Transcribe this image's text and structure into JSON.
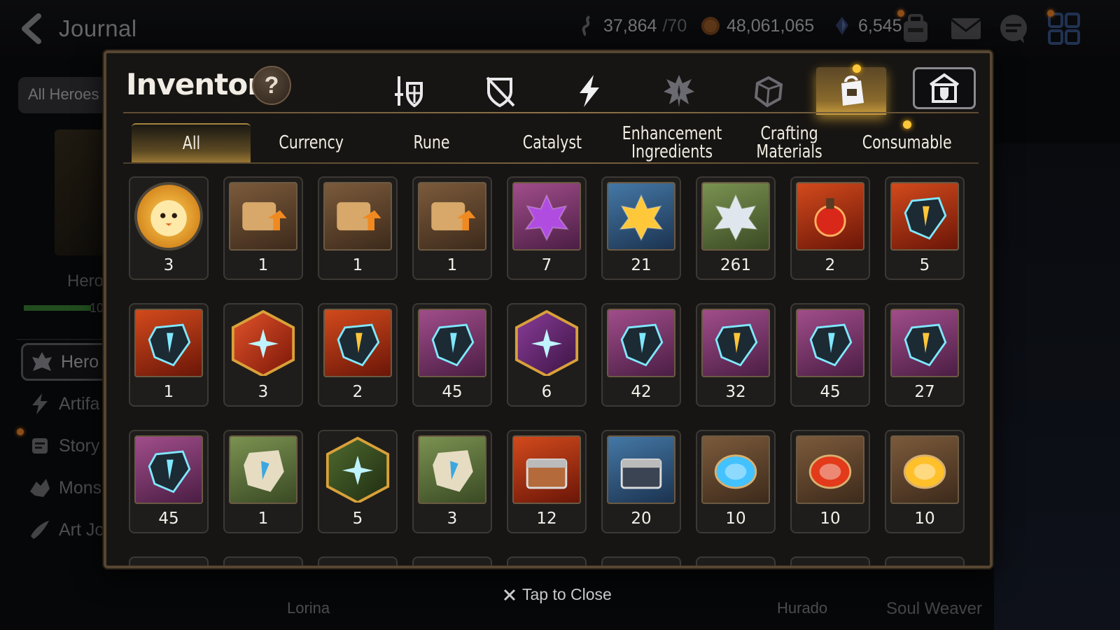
{
  "header": {
    "title": "Journal",
    "resources": [
      {
        "name": "stamina",
        "value": "37,864",
        "max": "/70",
        "icon": "stamina-icon"
      },
      {
        "name": "gold",
        "value": "48,061,065",
        "icon": "gold-icon"
      },
      {
        "name": "crystal",
        "value": "6,545",
        "icon": "crystal-icon"
      }
    ]
  },
  "sidebar": {
    "all_heroes": "All Heroes",
    "hero_text": "Hero",
    "bar_value": "10",
    "items": [
      {
        "label": "Hero J",
        "icon": "hero-journal-icon"
      },
      {
        "label": "Artifa",
        "icon": "lightning-icon"
      },
      {
        "label": "Story",
        "icon": "scroll-icon"
      },
      {
        "label": "Mons",
        "icon": "monster-icon"
      },
      {
        "label": "Art Jo",
        "icon": "brush-icon"
      }
    ]
  },
  "bottom": {
    "name_left": "Lorina",
    "name_right": "Hurado",
    "soul": "Soul Weaver"
  },
  "modal": {
    "title": "Inventory",
    "help": "?",
    "category_tabs": [
      {
        "name": "equipment",
        "icon": "sword-shield-icon"
      },
      {
        "name": "no-equip",
        "icon": "crossed-shield-icon"
      },
      {
        "name": "artifact",
        "icon": "lightning-icon"
      },
      {
        "name": "hero-materials",
        "icon": "spiky-emblem-icon"
      },
      {
        "name": "memory",
        "icon": "cube-icon"
      },
      {
        "name": "items",
        "icon": "bag-icon",
        "active": true
      },
      {
        "name": "storage",
        "icon": "shield-house-icon"
      }
    ],
    "sub_tabs": [
      "All",
      "Currency",
      "Rune",
      "Catalyst",
      "Enhancement\nIngredients",
      "Crafting\nMaterials",
      "Consumable"
    ],
    "items": [
      {
        "name": "mascot-coin",
        "qty": "3",
        "bg": "round"
      },
      {
        "name": "rainbow-scroll",
        "qty": "1",
        "bg": "bg-brown"
      },
      {
        "name": "dragon-scroll-a",
        "qty": "1",
        "bg": "bg-brown"
      },
      {
        "name": "dragon-scroll-b",
        "qty": "1",
        "bg": "bg-brown"
      },
      {
        "name": "purple-flower",
        "qty": "7",
        "bg": "bg-purple"
      },
      {
        "name": "gold-flower",
        "qty": "21",
        "bg": "bg-blue"
      },
      {
        "name": "silver-flower",
        "qty": "261",
        "bg": "bg-green"
      },
      {
        "name": "red-potion",
        "qty": "2",
        "bg": "bg-red"
      },
      {
        "name": "red-hammer-gem",
        "qty": "5",
        "bg": "bg-red"
      },
      {
        "name": "blue-hammer-rock",
        "qty": "1",
        "bg": "bg-red"
      },
      {
        "name": "red-star-hex",
        "qty": "3",
        "bg": "hex-red"
      },
      {
        "name": "red-blade-gem",
        "qty": "2",
        "bg": "bg-red"
      },
      {
        "name": "teal-rune-a",
        "qty": "45",
        "bg": "bg-purple"
      },
      {
        "name": "purple-star-hex",
        "qty": "6",
        "bg": "hex-purple"
      },
      {
        "name": "teal-boot-rune",
        "qty": "42",
        "bg": "bg-purple"
      },
      {
        "name": "gold-hammer-rune",
        "qty": "32",
        "bg": "bg-purple"
      },
      {
        "name": "teal-swirl-rune",
        "qty": "45",
        "bg": "bg-purple"
      },
      {
        "name": "gold-blade-rune",
        "qty": "27",
        "bg": "bg-purple"
      },
      {
        "name": "teal-sword-rune",
        "qty": "45",
        "bg": "bg-purple"
      },
      {
        "name": "stone-swirl-rune",
        "qty": "1",
        "bg": "bg-green"
      },
      {
        "name": "green-star-hex",
        "qty": "5",
        "bg": "hex-green"
      },
      {
        "name": "stone-sword-rune",
        "qty": "3",
        "bg": "bg-green"
      },
      {
        "name": "red-chest",
        "qty": "12",
        "bg": "bg-red"
      },
      {
        "name": "blue-chest",
        "qty": "20",
        "bg": "bg-blue"
      },
      {
        "name": "blue-orb",
        "qty": "10",
        "bg": "bg-brown"
      },
      {
        "name": "red-orb",
        "qty": "10",
        "bg": "bg-brown"
      },
      {
        "name": "gold-orb",
        "qty": "10",
        "bg": "bg-brown"
      }
    ]
  },
  "footer": {
    "close_text": "Tap to Close"
  },
  "colors": {
    "accent_gold": "#c79a3c",
    "frame": "#574631",
    "notif": "#ffc83a"
  }
}
